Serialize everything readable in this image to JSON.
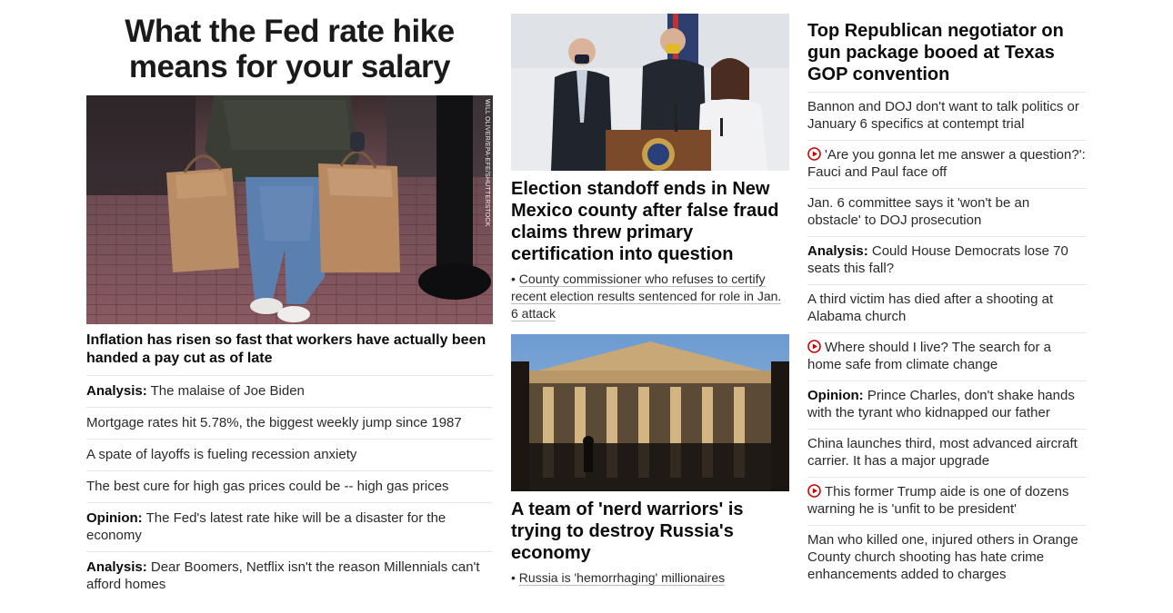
{
  "col1": {
    "headline": "What the Fed rate hike means for your salary",
    "image_alt": "Shopper carrying paper bags",
    "photo_credit": "WILL OLIVER/EPA-EFE/SHUTTERSTOCK",
    "caption": "Inflation has risen so fast that workers have actually been handed a pay cut as of late",
    "items": [
      {
        "tag": "Analysis:",
        "text": "The malaise of Joe Biden"
      },
      {
        "tag": "",
        "text": "Mortgage rates hit 5.78%, the biggest weekly jump since 1987"
      },
      {
        "tag": "",
        "text": "A spate of layoffs is fueling recession anxiety"
      },
      {
        "tag": "",
        "text": "The best cure for high gas prices could be -- high gas prices"
      },
      {
        "tag": "Opinion:",
        "text": "The Fed's latest rate hike will be a disaster for the economy"
      },
      {
        "tag": "Analysis:",
        "text": "Dear Boomers, Netflix isn't the reason Millennials can't afford homes"
      }
    ]
  },
  "col2": {
    "story1": {
      "headline": "Election standoff ends in New Mexico county after false fraud claims threw primary certification into question",
      "bullet": "County commissioner who refuses to certify recent election results sentenced for role in Jan. 6 attack"
    },
    "story2": {
      "headline": "A team of 'nerd warriors' is trying to destroy Russia's economy",
      "bullet": "Russia is 'hemorrhaging' millionaires"
    }
  },
  "col3": {
    "headline": "Top Republican negotiator on gun package booed at Texas GOP convention",
    "items": [
      {
        "tag": "",
        "video": false,
        "text": "Bannon and DOJ don't want to talk politics or January 6 specifics at contempt trial"
      },
      {
        "tag": "",
        "video": true,
        "text": "'Are you gonna let me answer a question?': Fauci and Paul face off"
      },
      {
        "tag": "",
        "video": false,
        "text": "Jan. 6 committee says it 'won't be an obstacle' to DOJ prosecution"
      },
      {
        "tag": "Analysis:",
        "video": false,
        "text": "Could House Democrats lose 70 seats this fall?"
      },
      {
        "tag": "",
        "video": false,
        "text": "A third victim has died after a shooting at Alabama church"
      },
      {
        "tag": "",
        "video": true,
        "text": "Where should I live? The search for a home safe from climate change"
      },
      {
        "tag": "Opinion:",
        "video": false,
        "text": "Prince Charles, don't shake hands with the tyrant who kidnapped our father"
      },
      {
        "tag": "",
        "video": false,
        "text": "China launches third, most advanced aircraft carrier. It has a major upgrade"
      },
      {
        "tag": "",
        "video": true,
        "text": "This former Trump aide is one of dozens warning he is 'unfit to be president'"
      },
      {
        "tag": "",
        "video": false,
        "text": "Man who killed one, injured others in Orange County church shooting has hate crime enhancements added to charges"
      }
    ]
  },
  "colors": {
    "video_red": "#cc0000",
    "divider": "#e6e6e6",
    "headline": "#0c0c0c"
  }
}
